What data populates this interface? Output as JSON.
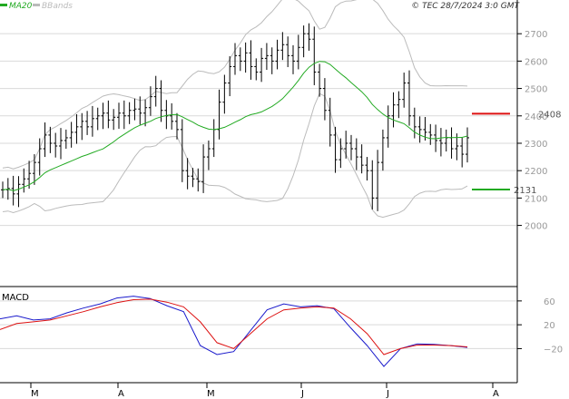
{
  "header": {
    "series_label": "MA20",
    "bands_label": "BBands",
    "copyright": "© TEC 28/7/2024 3:0 GMT"
  },
  "colors": {
    "price": "#000000",
    "ma": "#22aa22",
    "bands": "#bbbbbb",
    "grid": "#d9d9d9",
    "macd": "#1a1acc",
    "signal": "#dd1111",
    "resistance": "#dd1111",
    "support": "#22aa22"
  },
  "chart_data": [
    {
      "type": "ohlc",
      "title": "",
      "x": [
        "M",
        "A",
        "M",
        "J",
        "J",
        "A"
      ],
      "y_range": [
        1790,
        2790
      ],
      "y_ticks": [
        2000,
        2100,
        2200,
        2300,
        2400,
        2500,
        2600,
        2700
      ],
      "legend": [
        "MA20",
        "BBands"
      ],
      "closes": [
        2130,
        2135,
        2115,
        2150,
        2170,
        2190,
        2230,
        2280,
        2330,
        2300,
        2290,
        2310,
        2320,
        2340,
        2360,
        2380,
        2360,
        2390,
        2400,
        2410,
        2385,
        2395,
        2410,
        2400,
        2420,
        2425,
        2410,
        2430,
        2470,
        2500,
        2420,
        2400,
        2380,
        2350,
        2200,
        2180,
        2170,
        2160,
        2250,
        2280,
        2350,
        2450,
        2520,
        2580,
        2620,
        2600,
        2630,
        2580,
        2560,
        2610,
        2620,
        2600,
        2640,
        2660,
        2620,
        2600,
        2650,
        2700,
        2680,
        2560,
        2500,
        2420,
        2330,
        2240,
        2280,
        2300,
        2280,
        2250,
        2220,
        2200,
        2100,
        2230,
        2320,
        2400,
        2440,
        2460,
        2520,
        2400,
        2360,
        2350,
        2340,
        2330,
        2310,
        2300,
        2320,
        2280,
        2290,
        2260,
        2320
      ],
      "highs_lows": "each bar drawn with high/low range around the close",
      "series": [
        {
          "name": "MA20",
          "role": "moving average"
        },
        {
          "name": "BBands",
          "role": "upper and lower bands"
        }
      ],
      "levels": [
        {
          "value": 2408,
          "label": "2408"
        },
        {
          "value": 2131,
          "label": "2131"
        }
      ]
    },
    {
      "type": "line",
      "title": "MACD",
      "y_range": [
        -65,
        75
      ],
      "y_ticks": [
        60,
        20,
        -20
      ],
      "y_tick_labels": [
        "60",
        "20",
        "−20"
      ],
      "series": [
        {
          "name": "MACD",
          "values": [
            30,
            35,
            28,
            30,
            40,
            48,
            55,
            65,
            68,
            64,
            52,
            42,
            -15,
            -30,
            -25,
            10,
            45,
            55,
            50,
            52,
            47,
            15,
            -15,
            -50,
            -20,
            -12,
            -13,
            -15,
            -18
          ]
        },
        {
          "name": "Signal",
          "values": [
            12,
            22,
            25,
            28,
            35,
            42,
            50,
            57,
            62,
            63,
            58,
            50,
            25,
            -10,
            -20,
            5,
            30,
            45,
            48,
            50,
            48,
            30,
            5,
            -30,
            -20,
            -14,
            -14,
            -15,
            -17
          ]
        }
      ]
    }
  ]
}
